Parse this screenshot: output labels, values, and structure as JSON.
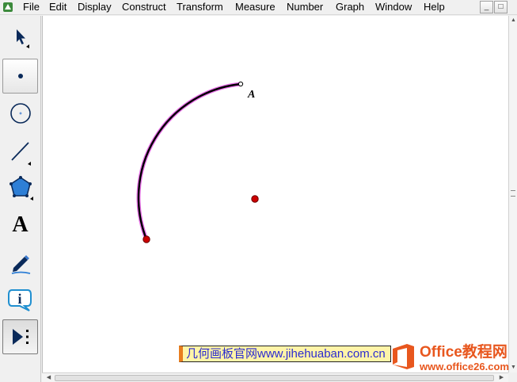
{
  "menubar": {
    "items": [
      "File",
      "Edit",
      "Display",
      "Construct",
      "Transform",
      "Measure",
      "Number",
      "Graph",
      "Window",
      "Help"
    ],
    "window_buttons": {
      "minimize": "_",
      "restore": "□"
    }
  },
  "toolbox": {
    "tools": [
      {
        "name": "arrow-tool",
        "icon": "arrow-icon"
      },
      {
        "name": "point-tool",
        "icon": "point-icon",
        "selected": true
      },
      {
        "name": "compass-tool",
        "icon": "circle-icon"
      },
      {
        "name": "straightedge-tool",
        "icon": "line-icon"
      },
      {
        "name": "polygon-tool",
        "icon": "polygon-icon"
      },
      {
        "name": "text-tool",
        "icon": "text-icon",
        "glyph": "A"
      },
      {
        "name": "marker-tool",
        "icon": "pen-icon"
      },
      {
        "name": "information-tool",
        "icon": "info-icon",
        "glyph": "i"
      },
      {
        "name": "custom-tool",
        "icon": "play-more-icon",
        "pressed": true
      }
    ]
  },
  "canvas": {
    "point_label": "A",
    "colors": {
      "arc": "#000000",
      "arc_highlight": "#e66ee6",
      "point_fill": "#cc0000"
    }
  },
  "watermarks": {
    "site_text": "几何画板官网www.jihehuaban.com.cn",
    "brand_title": "Office教程网",
    "brand_url": "www.office26.com"
  }
}
